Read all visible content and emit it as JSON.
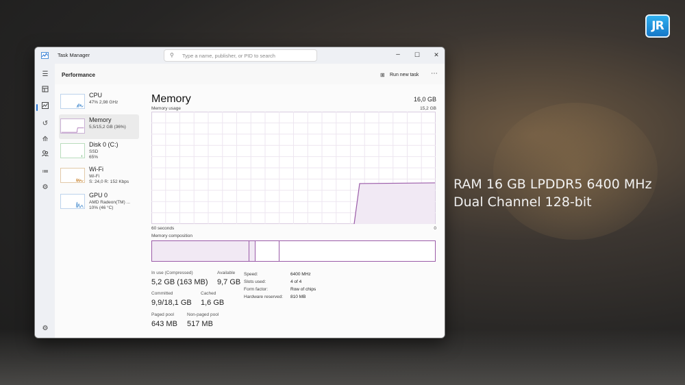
{
  "caption": {
    "line1": "RAM 16 GB LPDDR5 6400 MHz",
    "line2": "Dual Channel 128-bit"
  },
  "logo": {
    "text": "JR"
  },
  "window": {
    "title": "Task Manager",
    "search_placeholder": "Type a name, publisher, or PID to search",
    "controls": {
      "minimize": "–",
      "maximize": "☐",
      "close": "✕"
    }
  },
  "sidebar": {
    "icons": [
      "hamburger-icon",
      "processes-icon",
      "performance-icon",
      "app-history-icon",
      "startup-apps-icon",
      "users-icon",
      "details-icon",
      "services-icon",
      "settings-icon"
    ],
    "active": "performance-icon"
  },
  "header": {
    "title": "Performance",
    "run_new_task": "Run new task",
    "more": "⋯"
  },
  "tiles": [
    {
      "name": "CPU",
      "sub1": "47% 2,98 GHz",
      "sub2": "",
      "sub3": ""
    },
    {
      "name": "Memory",
      "sub1": "5,5/15,2 GB (36%)",
      "sub2": "",
      "sub3": ""
    },
    {
      "name": "Disk 0 (C:)",
      "sub1": "SSD",
      "sub2": "65%",
      "sub3": ""
    },
    {
      "name": "Wi-Fi",
      "sub1": "Wi-Fi",
      "sub2": "S: 24,0  R: 152 Kbps",
      "sub3": ""
    },
    {
      "name": "GPU 0",
      "sub1": "AMD Radeon(TM) ...",
      "sub2": "10% (46 °C)",
      "sub3": ""
    }
  ],
  "memory": {
    "title": "Memory",
    "total": "16,0 GB",
    "usage_label": "Memory usage",
    "usage_max": "15,2 GB",
    "axis_left": "60 seconds",
    "axis_right": "0",
    "composition_label": "Memory composition",
    "usage_level_fraction": 0.36,
    "stats": {
      "in_use_label": "In use (Compressed)",
      "in_use": "5,2 GB (163 MB)",
      "available_label": "Available",
      "available": "9,7 GB",
      "committed_label": "Committed",
      "committed": "9,9/18,1 GB",
      "cached_label": "Cached",
      "cached": "1,6 GB",
      "paged_label": "Paged pool",
      "paged": "643 MB",
      "nonpaged_label": "Non-paged pool",
      "nonpaged": "517 MB"
    },
    "details": [
      {
        "k": "Speed:",
        "v": "6400 MHz"
      },
      {
        "k": "Slots used:",
        "v": "4 of 4"
      },
      {
        "k": "Form factor:",
        "v": "Row of chips"
      },
      {
        "k": "Hardware reserved:",
        "v": "810 MB"
      }
    ]
  },
  "colors": {
    "accent": "#1f6fd1",
    "memory_line": "#9a5aa8",
    "memory_fill": "#f1e9f4"
  }
}
